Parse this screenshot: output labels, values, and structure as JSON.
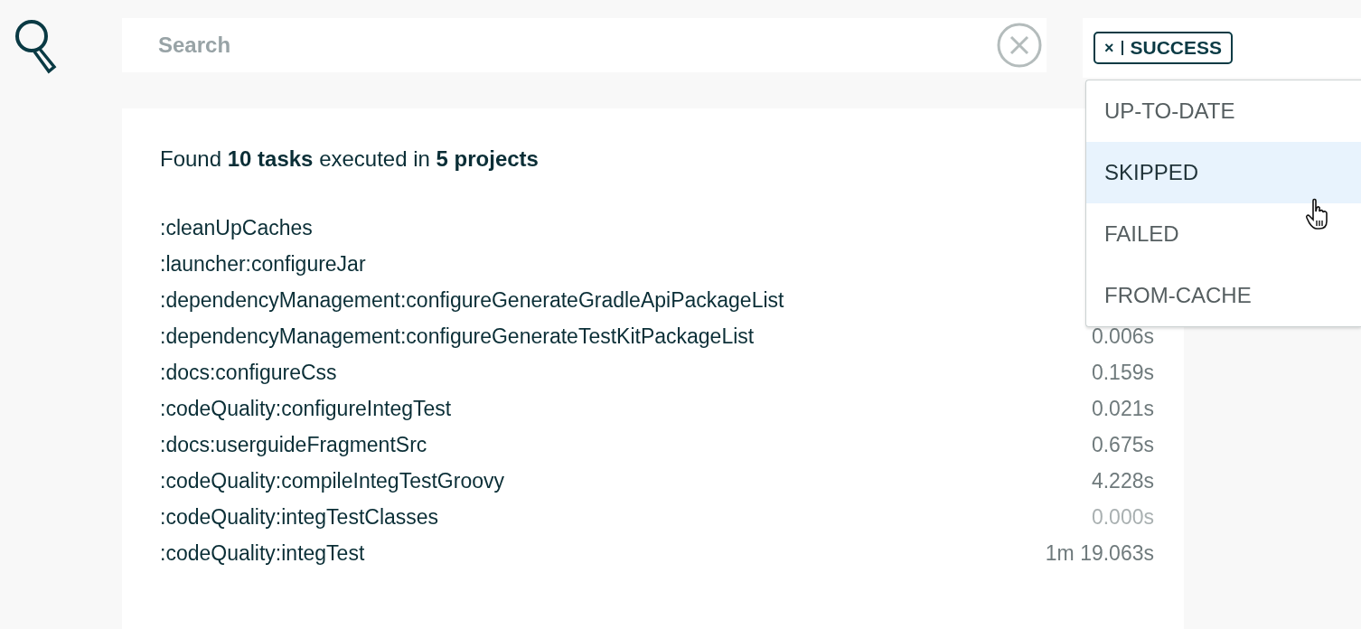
{
  "search": {
    "placeholder": "Search"
  },
  "filter": {
    "tags": [
      {
        "remove": "×",
        "label": "SUCCESS"
      }
    ],
    "options": [
      {
        "label": "UP-TO-DATE",
        "highlighted": false
      },
      {
        "label": "SKIPPED",
        "highlighted": true
      },
      {
        "label": "FAILED",
        "highlighted": false
      },
      {
        "label": "FROM-CACHE",
        "highlighted": false
      }
    ]
  },
  "summary": "Found **10 tasks** executed in **5 projects**",
  "tasks": [
    {
      "name": ":cleanUpCaches"
    },
    {
      "name": ":launcher:configureJar"
    },
    {
      "name": ":dependencyManagement:configureGenerateGradleApiPackageList"
    },
    {
      "name": ":dependencyManagement:configureGenerateTestKitPackageList",
      "duration": "0.006s",
      "muted": false
    },
    {
      "name": ":docs:configureCss",
      "duration": "0.159s",
      "muted": false
    },
    {
      "name": ":codeQuality:configureIntegTest",
      "duration": "0.021s",
      "muted": false
    },
    {
      "name": ":docs:userguideFragmentSrc",
      "duration": "0.675s",
      "muted": false
    },
    {
      "name": ":codeQuality:compileIntegTestGroovy",
      "duration": "4.228s",
      "muted": false
    },
    {
      "name": ":codeQuality:integTestClasses",
      "duration": "0.000s",
      "muted": true
    },
    {
      "name": ":codeQuality:integTest",
      "duration": "1m 19.063s",
      "muted": false
    }
  ]
}
